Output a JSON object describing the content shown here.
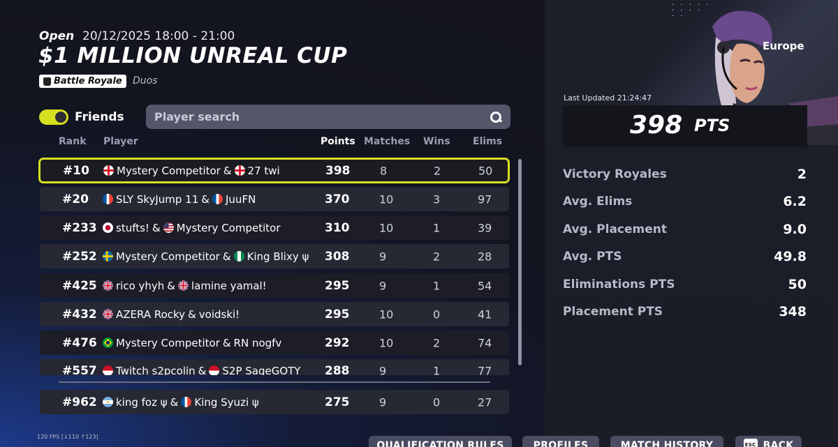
{
  "event": {
    "status": "Open",
    "datetime": "20/12/2025 18:00 - 21:00",
    "title": "$1 MILLION UNREAL CUP",
    "mode": "Battle Royale",
    "team_type": "Duos",
    "region": "Europe"
  },
  "filters": {
    "friends_label": "Friends",
    "friends_on": true,
    "search_placeholder": "Player search"
  },
  "table": {
    "headers": {
      "rank": "Rank",
      "player": "Player",
      "points": "Points",
      "matches": "Matches",
      "wins": "Wins",
      "elims": "Elims"
    },
    "rows": [
      {
        "rank": "#10",
        "p1": "Mystery Competitor",
        "f1": "gb-eng",
        "p2": "27 twi",
        "f2": "gb-eng",
        "points": "398",
        "matches": "8",
        "wins": "2",
        "elims": "50"
      },
      {
        "rank": "#20",
        "p1": "SLY SkyJump 11",
        "f1": "fr",
        "p2": "JuuFN",
        "f2": "fr",
        "points": "370",
        "matches": "10",
        "wins": "3",
        "elims": "97"
      },
      {
        "rank": "#233",
        "p1": "stufts!",
        "f1": "jp",
        "p2": "Mystery Competitor",
        "f2": "us",
        "points": "310",
        "matches": "10",
        "wins": "1",
        "elims": "39"
      },
      {
        "rank": "#252",
        "p1": "Mystery Competitor",
        "f1": "se",
        "p2": "King Blixy ψ",
        "f2": "ng",
        "points": "308",
        "matches": "9",
        "wins": "2",
        "elims": "28"
      },
      {
        "rank": "#425",
        "p1": "rico yhyh",
        "f1": "uk",
        "p2": "lamine yamal!",
        "f2": "uk",
        "points": "295",
        "matches": "9",
        "wins": "1",
        "elims": "54"
      },
      {
        "rank": "#432",
        "p1": "AZERA Rocky",
        "f1": "uk",
        "p2": "voidski!",
        "f2": "",
        "points": "295",
        "matches": "10",
        "wins": "0",
        "elims": "41"
      },
      {
        "rank": "#476",
        "p1": "Mystery Competitor",
        "f1": "br",
        "p2": "RN nogfv",
        "f2": "",
        "points": "292",
        "matches": "10",
        "wins": "2",
        "elims": "74"
      },
      {
        "rank": "#557",
        "p1": "Twitch s2pcolin",
        "f1": "id",
        "p2": "S2P SageGOTY",
        "f2": "id",
        "points": "288",
        "matches": "9",
        "wins": "1",
        "elims": "77"
      }
    ],
    "pinned_row": {
      "rank": "#962",
      "p1": "king foz ψ",
      "f1": "ar",
      "p2": "King Syuzi ψ",
      "f2": "fr",
      "points": "275",
      "matches": "9",
      "wins": "0",
      "elims": "27"
    },
    "joiner": "&"
  },
  "stats": {
    "last_updated": "Last Updated 21:24:47",
    "points_value": "398",
    "points_unit": "PTS",
    "items": [
      {
        "label": "Victory Royales",
        "value": "2"
      },
      {
        "label": "Avg. Elims",
        "value": "6.2"
      },
      {
        "label": "Avg. Placement",
        "value": "9.0"
      },
      {
        "label": "Avg. PTS",
        "value": "49.8"
      },
      {
        "label": "Eliminations PTS",
        "value": "50"
      },
      {
        "label": "Placement PTS",
        "value": "348"
      }
    ]
  },
  "footer": {
    "fps": "120 FPS [↓110 ↑123]",
    "buttons": [
      "QUALIFICATION RULES",
      "PROFILES",
      "MATCH HISTORY",
      "BACK"
    ],
    "esc_key": "ESC"
  },
  "colors": {
    "accent": "#d6e020",
    "search_bg": "#54566a",
    "row_bg": "#262834",
    "row_alt_bg": "#1c1d27"
  }
}
